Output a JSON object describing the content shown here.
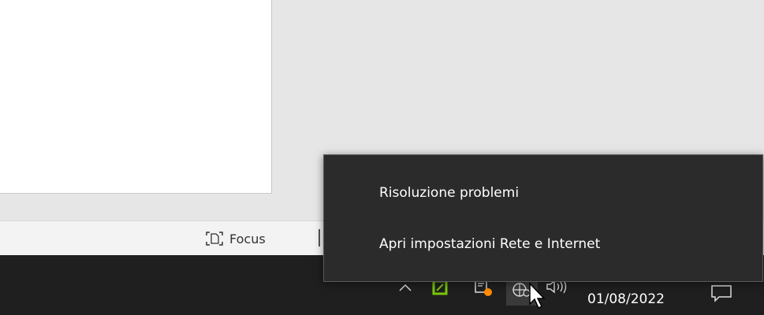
{
  "status_bar": {
    "focus_label": "Focus"
  },
  "taskbar": {
    "clock_date": "01/08/2022",
    "icons": [
      "chevron-up-icon",
      "green-app-icon",
      "app-with-badge-icon",
      "network-icon",
      "volume-icon",
      "notification-icon"
    ]
  },
  "context_menu": {
    "items": [
      {
        "label": "Risoluzione problemi"
      },
      {
        "label": "Apri impostazioni Rete e Internet"
      }
    ]
  },
  "colors": {
    "taskbar_bg": "#1f1f1f",
    "menu_bg": "#2b2b2b",
    "badge_orange": "#ff8c00",
    "app_green": "#7ac70c"
  }
}
